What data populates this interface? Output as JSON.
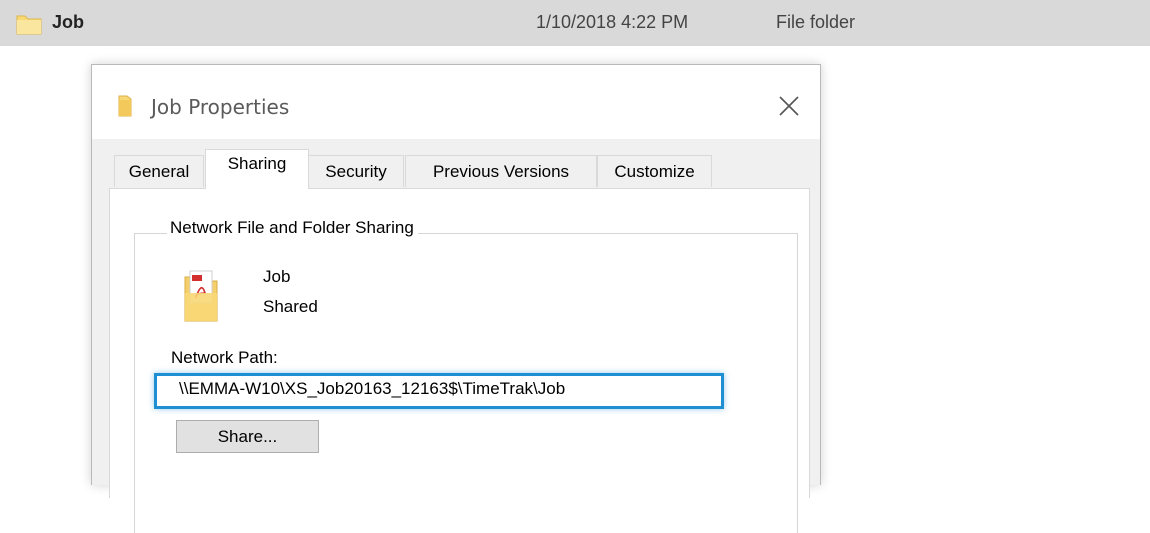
{
  "explorer_row": {
    "name": "Job",
    "date_modified": "1/10/2018 4:22 PM",
    "type": "File folder",
    "icon": "folder-icon"
  },
  "dialog": {
    "title": "Job Properties",
    "icon": "folder-icon",
    "close_icon": "close-icon",
    "tabs": [
      {
        "label": "General",
        "active": false
      },
      {
        "label": "Sharing",
        "active": true
      },
      {
        "label": "Security",
        "active": false
      },
      {
        "label": "Previous Versions",
        "active": false
      },
      {
        "label": "Customize",
        "active": false
      }
    ],
    "sharing": {
      "group_label": "Network File and Folder Sharing",
      "item_icon": "pdf-folder-icon",
      "item_name": "Job",
      "item_status": "Shared",
      "network_path_label": "Network Path:",
      "network_path_value": "\\\\EMMA-W10\\XS_Job20163_12163$\\TimeTrak\\Job",
      "share_button_label": "Share...",
      "highlight_color": "#1e8fd3"
    }
  }
}
